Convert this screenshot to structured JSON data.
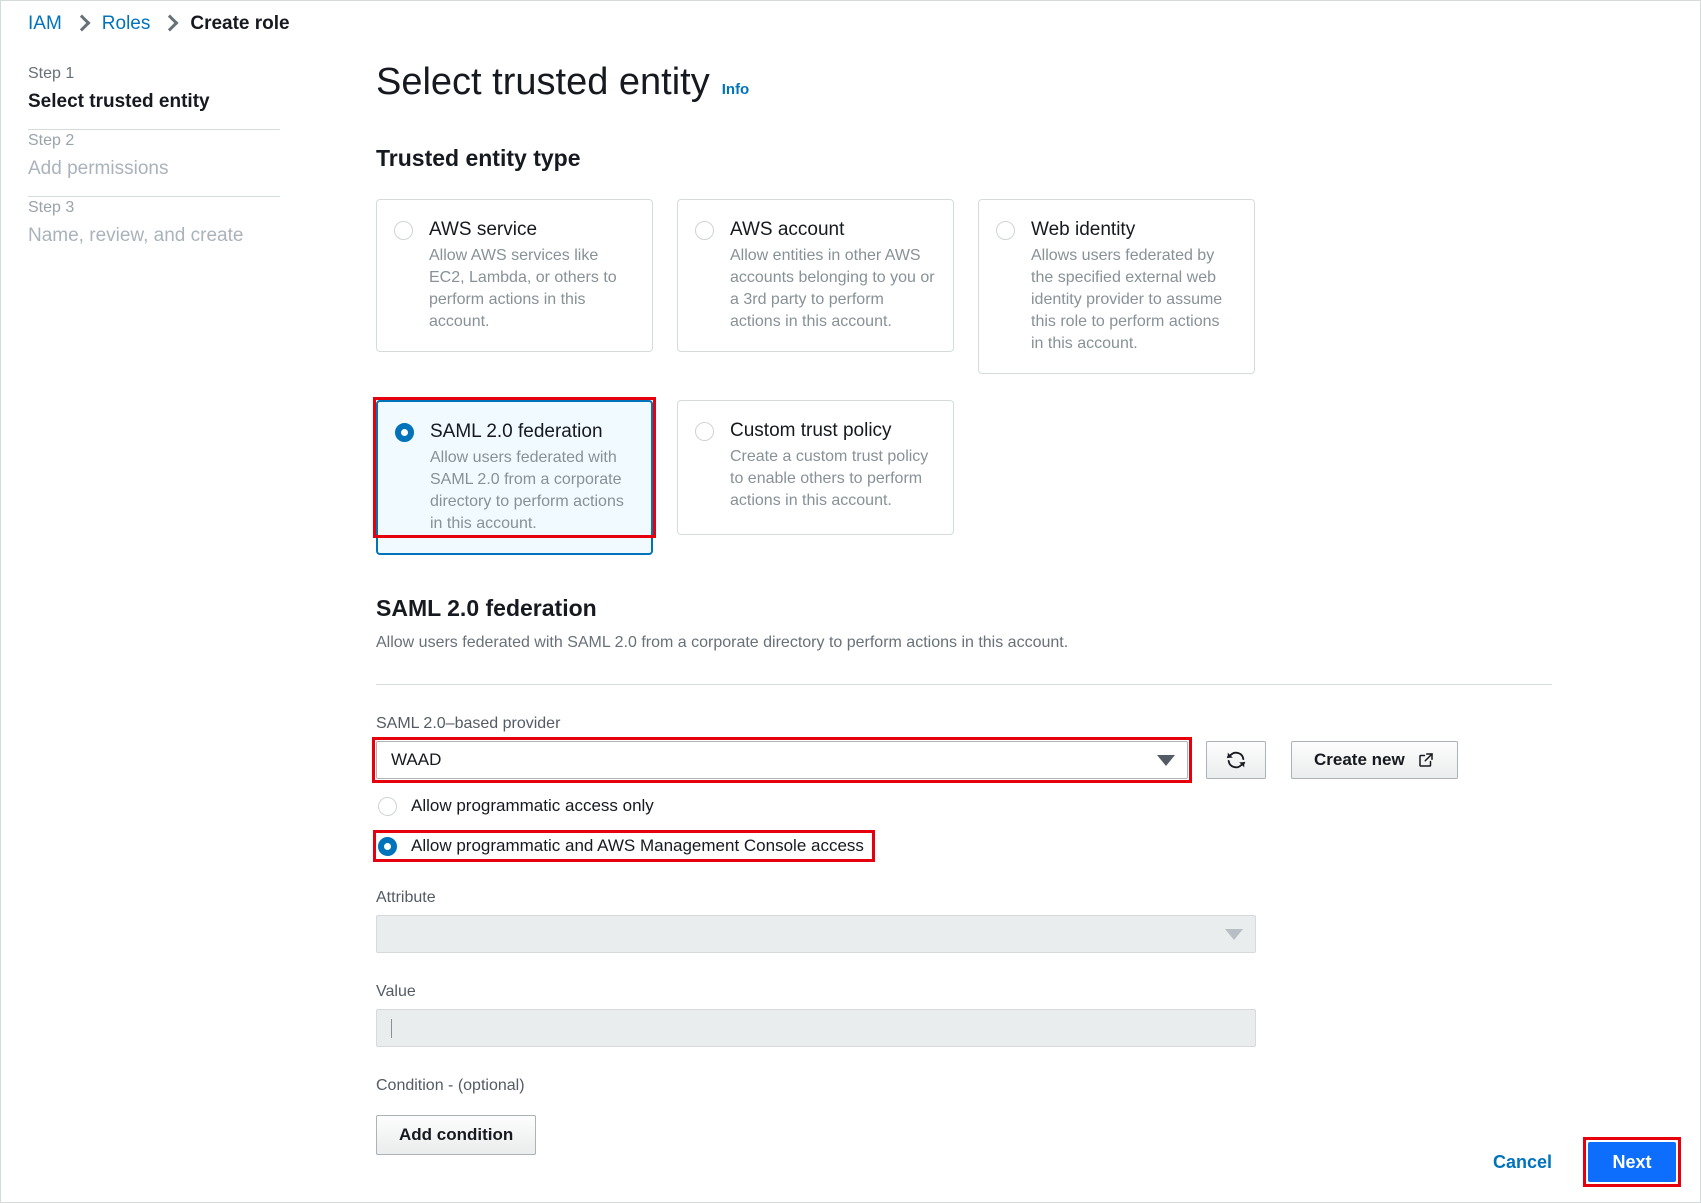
{
  "breadcrumb": {
    "items": [
      {
        "label": "IAM",
        "current": false
      },
      {
        "label": "Roles",
        "current": false
      },
      {
        "label": "Create role",
        "current": true
      }
    ]
  },
  "steps": [
    {
      "num": "Step 1",
      "name": "Select trusted entity",
      "active": true
    },
    {
      "num": "Step 2",
      "name": "Add permissions",
      "active": false
    },
    {
      "num": "Step 3",
      "name": "Name, review, and create",
      "active": false
    }
  ],
  "header": {
    "title": "Select trusted entity",
    "info_label": "Info"
  },
  "trusted_entity": {
    "section_title": "Trusted entity type",
    "options": [
      {
        "label": "AWS service",
        "description": "Allow AWS services like EC2, Lambda, or others to perform actions in this account.",
        "selected": false
      },
      {
        "label": "AWS account",
        "description": "Allow entities in other AWS accounts belonging to you or a 3rd party to perform actions in this account.",
        "selected": false
      },
      {
        "label": "Web identity",
        "description": "Allows users federated by the specified external web identity provider to assume this role to perform actions in this account.",
        "selected": false
      },
      {
        "label": "SAML 2.0 federation",
        "description": "Allow users federated with SAML 2.0 from a corporate directory to perform actions in this account.",
        "selected": true
      },
      {
        "label": "Custom trust policy",
        "description": "Create a custom trust policy to enable others to perform actions in this account.",
        "selected": false
      }
    ]
  },
  "saml_section": {
    "heading": "SAML 2.0 federation",
    "description": "Allow users federated with SAML 2.0 from a corporate directory to perform actions in this account.",
    "provider_label": "SAML 2.0–based provider",
    "provider_value": "WAAD",
    "refresh_icon": "refresh-icon",
    "create_new_label": "Create new",
    "create_new_icon": "external-link-icon",
    "access_options": [
      {
        "label": "Allow programmatic access only",
        "selected": false
      },
      {
        "label": "Allow programmatic and AWS Management Console access",
        "selected": true
      }
    ],
    "attribute_label": "Attribute",
    "attribute_value": "",
    "value_label": "Value",
    "value_text": "",
    "condition_label": "Condition - (optional)",
    "add_condition_label": "Add condition"
  },
  "footer": {
    "cancel_label": "Cancel",
    "next_label": "Next"
  },
  "colors": {
    "link": "#0073bb",
    "highlight": "#e6000d",
    "selected_tile_bg": "#f1faff",
    "selected_border": "#0073bb",
    "primary_button": "#0d6efd"
  }
}
